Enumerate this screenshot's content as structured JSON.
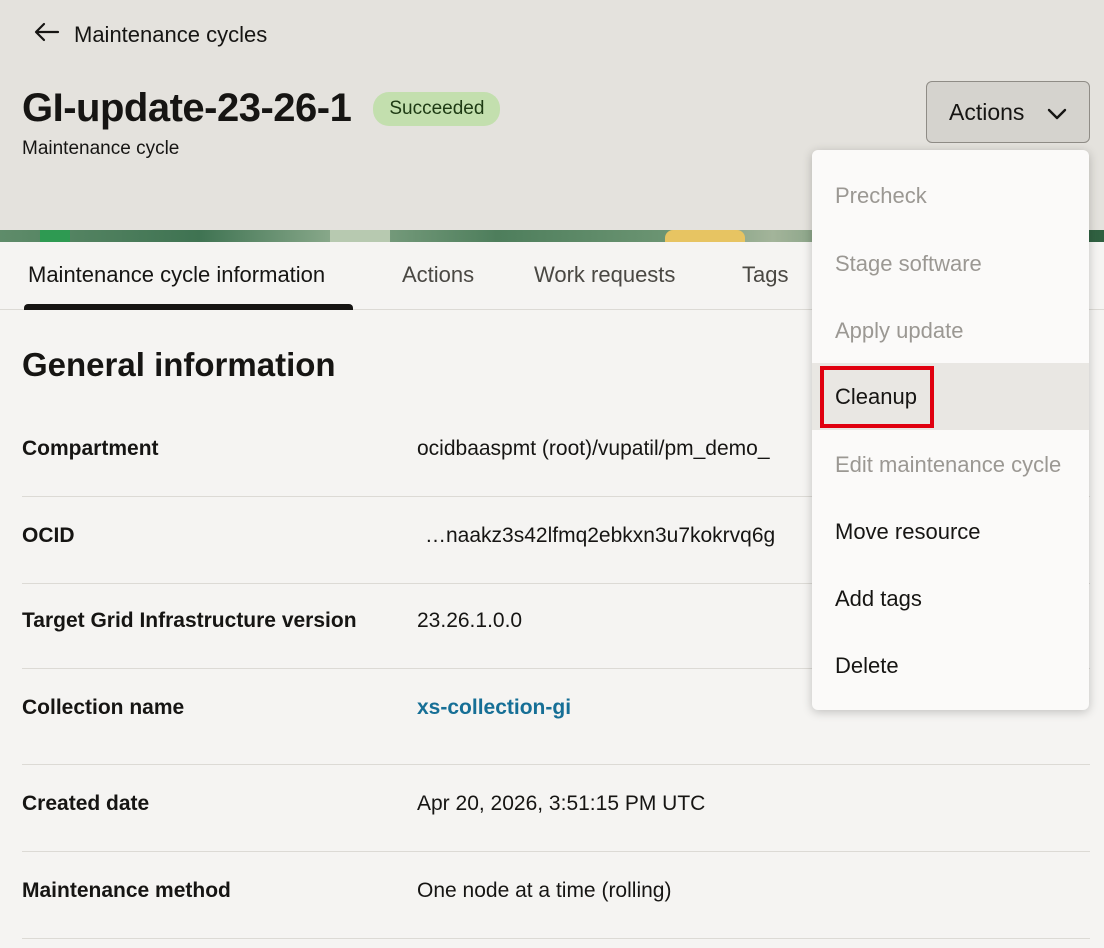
{
  "back_link": {
    "label": "Maintenance cycles",
    "icon": "arrow-left-icon"
  },
  "header": {
    "title": "GI-update-23-26-1",
    "status": "Succeeded",
    "subtitle": "Maintenance cycle",
    "actions_button": "Actions",
    "status_color": "#c3dfae"
  },
  "tabs": [
    {
      "label": "Maintenance cycle information",
      "active": true
    },
    {
      "label": "Actions"
    },
    {
      "label": "Work requests"
    },
    {
      "label": "Tags"
    }
  ],
  "general": {
    "title": "General information",
    "rows": [
      {
        "label": "Compartment",
        "value": "ocidbaaspmt (root)/vupatil/pm_demo_"
      },
      {
        "label": "OCID",
        "value": "…naakz3s42lfmq2ebkxn3u7kokrvq6g"
      },
      {
        "label": "Target Grid Infrastructure version",
        "value": "23.26.1.0.0"
      },
      {
        "label": "Collection name",
        "value": "xs-collection-gi"
      },
      {
        "label": "Created date",
        "value": "Apr 20, 2026, 3:51:15 PM UTC"
      },
      {
        "label": "Maintenance method",
        "value": "One node at a time (rolling)"
      }
    ]
  },
  "actions_menu": {
    "items": [
      {
        "label": "Precheck",
        "enabled": false
      },
      {
        "label": "Stage software",
        "enabled": false
      },
      {
        "label": "Apply update",
        "enabled": false
      },
      {
        "label": "Cleanup",
        "enabled": true,
        "highlighted": true
      },
      {
        "label": "Edit maintenance cycle",
        "enabled": false
      },
      {
        "label": "Move resource",
        "enabled": true
      },
      {
        "label": "Add tags",
        "enabled": true
      },
      {
        "label": "Delete",
        "enabled": true
      }
    ]
  },
  "colors": {
    "link": "#166f96",
    "highlight": "#e0000f"
  }
}
